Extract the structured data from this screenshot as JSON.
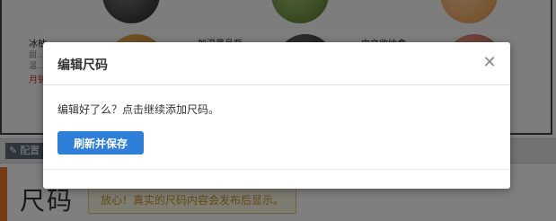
{
  "background": {
    "products": [
      {
        "name": "冰柚",
        "sub1": "甜...",
        "sub2": "温...",
        "price_text": "月销..."
      },
      {
        "name": "加温黑品瓶"
      },
      {
        "name": "中文收纳盒"
      }
    ],
    "config_tab": {
      "label": "配置",
      "icon": "pencil-icon"
    },
    "size_section": {
      "title": "尺码",
      "notice": "放心！真实的尺码内容会发布后显示。",
      "accent_color": "#e8772e"
    }
  },
  "modal": {
    "title": "编辑尺码",
    "close_icon": "close-icon",
    "message": "编辑好了么？点击继续添加尺码。",
    "primary_button": "刷新并保存",
    "primary_color": "#2f7ed8"
  }
}
